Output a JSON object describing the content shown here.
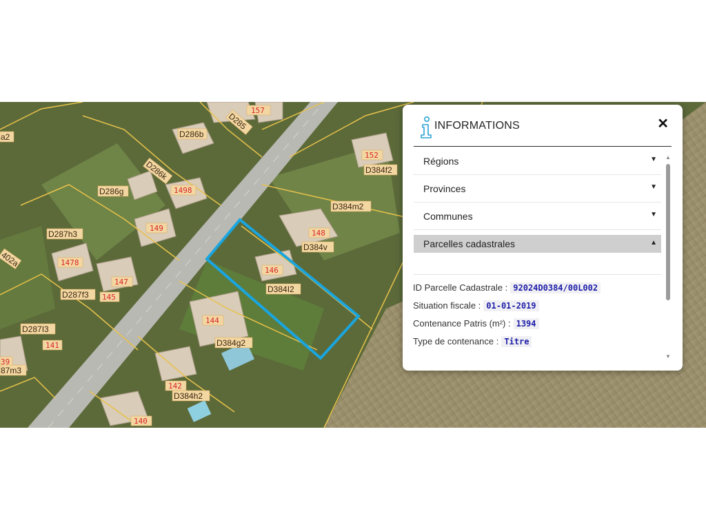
{
  "map": {
    "parcel_labels": [
      {
        "id": "a2",
        "text": "a2"
      },
      {
        "id": "d286b",
        "text": "D286b"
      },
      {
        "id": "d286k",
        "text": "D286k"
      },
      {
        "id": "n1498",
        "text": "1498"
      },
      {
        "id": "d286g",
        "text": "D286g"
      },
      {
        "id": "n149",
        "text": "149"
      },
      {
        "id": "d287h3",
        "text": "D287h3"
      },
      {
        "id": "n402a",
        "text": "402a"
      },
      {
        "id": "n1478",
        "text": "1478"
      },
      {
        "id": "n147",
        "text": "147"
      },
      {
        "id": "d287f3",
        "text": "D287f3"
      },
      {
        "id": "n145",
        "text": "145"
      },
      {
        "id": "d287i3",
        "text": "D287I3"
      },
      {
        "id": "n141",
        "text": "141"
      },
      {
        "id": "n39",
        "text": "39"
      },
      {
        "id": "n87m3",
        "text": "87m3"
      },
      {
        "id": "n157",
        "text": "157"
      },
      {
        "id": "d285",
        "text": "D285"
      },
      {
        "id": "n152",
        "text": "152"
      },
      {
        "id": "d384f2",
        "text": "D384f2"
      },
      {
        "id": "d384m2",
        "text": "D384m2"
      },
      {
        "id": "n148",
        "text": "148"
      },
      {
        "id": "d384v",
        "text": "D384v"
      },
      {
        "id": "n146",
        "text": "146"
      },
      {
        "id": "d384l2",
        "text": "D384I2"
      },
      {
        "id": "n144",
        "text": "144"
      },
      {
        "id": "d384g2",
        "text": "D384g2"
      },
      {
        "id": "n142",
        "text": "142"
      },
      {
        "id": "d384h2",
        "text": "D384h2"
      },
      {
        "id": "n140",
        "text": "140"
      }
    ],
    "colors": {
      "highlight": "#19a6e0",
      "parcel_line": "#e8c24a",
      "road": "#b9b9b3",
      "label_bg": "#f3d7a2",
      "parcel_number": "#d8252b"
    }
  },
  "panel": {
    "title": "INFORMATIONS",
    "icon": "info-icon",
    "close_icon": "close-icon",
    "sections": [
      {
        "label": "Régions",
        "state": "collapsed"
      },
      {
        "label": "Provinces",
        "state": "collapsed"
      },
      {
        "label": "Communes",
        "state": "collapsed"
      },
      {
        "label": "Parcelles cadastrales",
        "state": "expanded"
      }
    ],
    "details": [
      {
        "label": "ID Parcelle Cadastrale :",
        "value": "92024D0384/00L002"
      },
      {
        "label": "Situation fiscale :",
        "value": "01-01-2019"
      },
      {
        "label": "Contenance Patris (m²) :",
        "value": "1394"
      },
      {
        "label": "Type de contenance :",
        "value": "Titre"
      }
    ],
    "caret_down": "▼",
    "caret_up": "▲",
    "close_glyph": "✕",
    "scroll_up": "▲",
    "scroll_down": "▼"
  }
}
